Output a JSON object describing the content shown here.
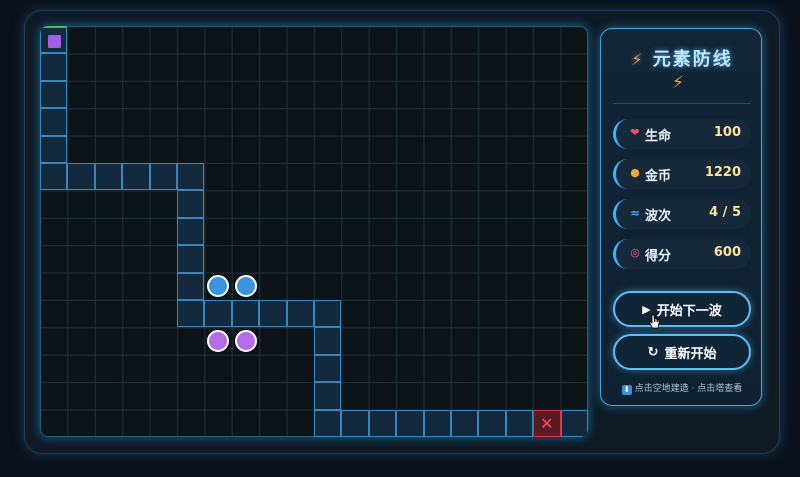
{
  "game": {
    "title": "元素防线",
    "title_icon": "lightning-bolt-icon",
    "bolt_glyph": "⚡"
  },
  "board": {
    "columns": 20,
    "rows": 15,
    "path_cells": [
      [
        0,
        0
      ],
      [
        0,
        1
      ],
      [
        0,
        2
      ],
      [
        0,
        3
      ],
      [
        0,
        4
      ],
      [
        0,
        5
      ],
      [
        1,
        5
      ],
      [
        2,
        5
      ],
      [
        3,
        5
      ],
      [
        4,
        5
      ],
      [
        5,
        5
      ],
      [
        5,
        6
      ],
      [
        5,
        7
      ],
      [
        5,
        8
      ],
      [
        5,
        9
      ],
      [
        5,
        10
      ],
      [
        6,
        10
      ],
      [
        7,
        10
      ],
      [
        8,
        10
      ],
      [
        9,
        10
      ],
      [
        10,
        10
      ],
      [
        10,
        11
      ],
      [
        10,
        12
      ],
      [
        10,
        13
      ],
      [
        10,
        14
      ],
      [
        11,
        14
      ],
      [
        12,
        14
      ],
      [
        13,
        14
      ],
      [
        14,
        14
      ],
      [
        15,
        14
      ],
      [
        16,
        14
      ],
      [
        17,
        14
      ],
      [
        18,
        14
      ],
      [
        19,
        14
      ]
    ],
    "spawn": [
      0,
      0
    ],
    "base": [
      18,
      14
    ],
    "base_glyph": "✕",
    "towers": [
      {
        "col": 6,
        "row": 9,
        "element": "water",
        "color": "#3a93df"
      },
      {
        "col": 7,
        "row": 9,
        "element": "water",
        "color": "#3a93df"
      },
      {
        "col": 6,
        "row": 11,
        "element": "arcane",
        "color": "#b56ce8"
      },
      {
        "col": 7,
        "row": 11,
        "element": "arcane",
        "color": "#b56ce8"
      }
    ]
  },
  "stats": [
    {
      "name": "lives",
      "icon": "heart-icon",
      "glyph": "❤",
      "icon_color": "#ff4d6d",
      "label": "生命",
      "value": "100"
    },
    {
      "name": "gold",
      "icon": "coin-icon",
      "glyph": "●",
      "icon_color": "#e6a93a",
      "label": "金币",
      "value": "1220"
    },
    {
      "name": "wave",
      "icon": "wave-icon",
      "glyph": "🌊",
      "icon_color": "#4aa8ff",
      "label": "波次",
      "value": "4 / 5"
    },
    {
      "name": "score",
      "icon": "target-icon",
      "glyph": "◎",
      "icon_color": "#ff5b8a",
      "label": "得分",
      "value": "600"
    }
  ],
  "buttons": {
    "next_wave": {
      "label": "开始下一波",
      "icon": "play-icon",
      "glyph": "▶"
    },
    "restart": {
      "label": "重新开始",
      "icon": "restart-icon",
      "glyph": "↻"
    }
  },
  "hint": {
    "icon": "info-icon",
    "glyph": "⬇",
    "text": "点击空地建造 · 点击塔查看"
  },
  "colors": {
    "accent": "#3fb4ff",
    "path_border": "#3a86bf",
    "spawn": "#a25de2",
    "base": "#d8334a"
  }
}
